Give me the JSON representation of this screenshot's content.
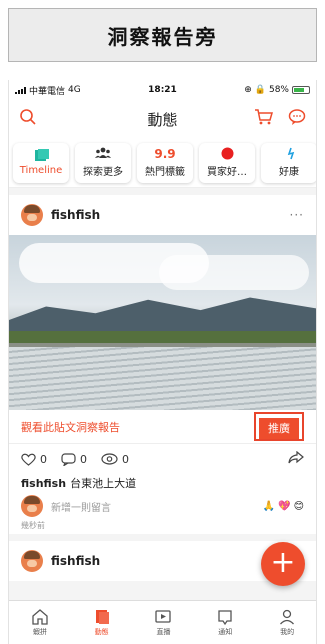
{
  "banner": {
    "title": "洞察報告旁"
  },
  "status_bar": {
    "carrier": "中華電信",
    "network": "4G",
    "time": "18:21",
    "battery": "58%"
  },
  "app_bar": {
    "title": "動態"
  },
  "tabs": [
    {
      "label": "Timeline",
      "icon": "timeline-icon",
      "badge": ""
    },
    {
      "label": "探索更多",
      "icon": "people-icon",
      "badge": ""
    },
    {
      "label": "熱門標籤",
      "icon": "hot-tag-icon",
      "badge": "9.9"
    },
    {
      "label": "買家好…",
      "icon": "red-dot-icon",
      "badge": ""
    },
    {
      "label": "好康",
      "icon": "deal-icon",
      "badge": ""
    }
  ],
  "post": {
    "username": "fishfish",
    "more": "···",
    "insight_link": "觀看此貼文洞察報告",
    "promote_label": "推廣",
    "likes": "0",
    "comments": "0",
    "views": "0",
    "caption_user": "fishfish",
    "caption_text": "台東池上大道",
    "comment_placeholder": "新增一則留言",
    "reactions": [
      "🙏",
      "💖",
      "😊"
    ],
    "time_ago": "幾秒前"
  },
  "post2": {
    "username": "fishfish",
    "more": "···"
  },
  "fab": {
    "label": "+"
  },
  "bottom_nav": [
    {
      "label": "蝦拼",
      "icon": "home-icon"
    },
    {
      "label": "動態",
      "icon": "feed-icon"
    },
    {
      "label": "直播",
      "icon": "live-icon"
    },
    {
      "label": "通知",
      "icon": "notification-icon"
    },
    {
      "label": "我的",
      "icon": "profile-icon"
    }
  ],
  "colors": {
    "accent": "#ee4d2d",
    "banner_bg": "#ececec",
    "highlight_border": "#e8452c"
  }
}
